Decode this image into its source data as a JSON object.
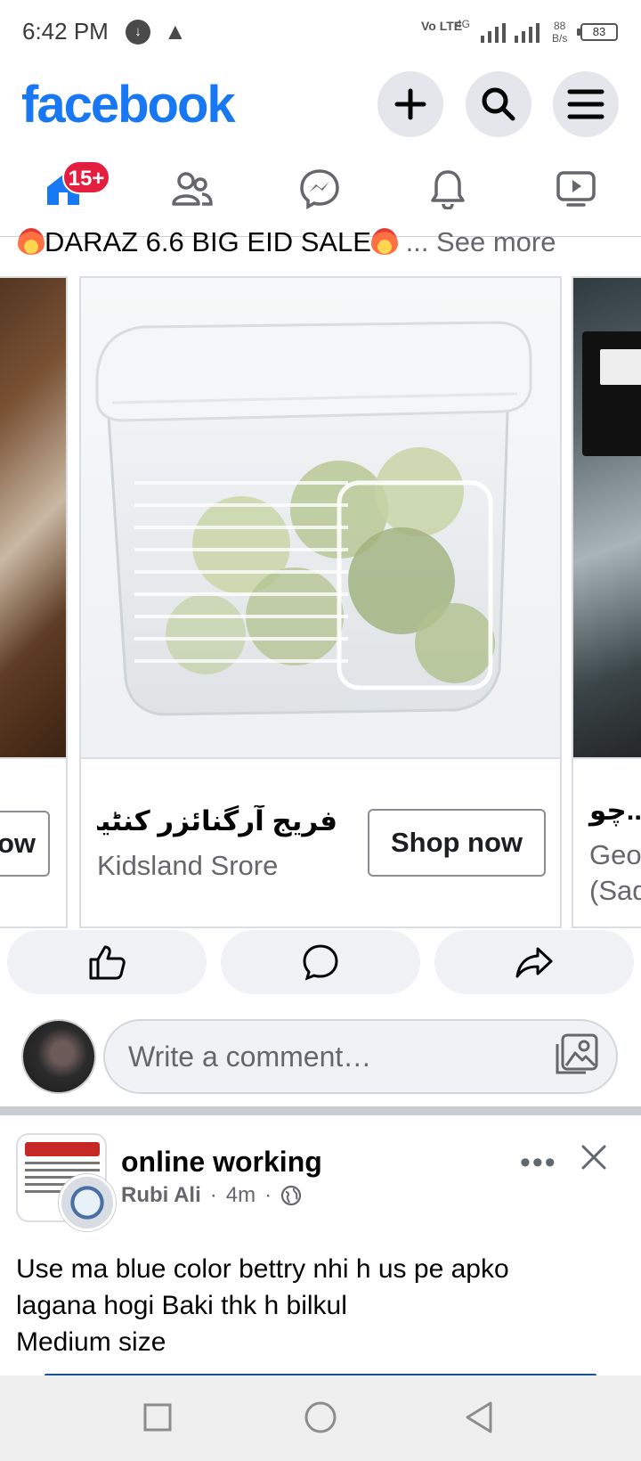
{
  "status_bar": {
    "time": "6:42 PM",
    "network_type": "Vo LTE",
    "signal_label": "4G",
    "speed_value": "88",
    "speed_unit": "B/s",
    "battery": "83"
  },
  "header": {
    "logo": "facebook"
  },
  "nav": {
    "home_badge": "15+"
  },
  "ad_post": {
    "text": "DARAZ 6.6 BIG EID SALE",
    "see_more": "... See more",
    "cards": [
      {
        "subtitle_partial": "ow"
      },
      {
        "title": "فریج آرگنائزر کنٹین...",
        "subtitle": "Kidsland Srore",
        "button": "Shop now"
      },
      {
        "title_partial": "چو...",
        "subtitle_line1": "Geo",
        "subtitle_line2": "(Sad"
      }
    ]
  },
  "comment": {
    "placeholder": "Write a comment…"
  },
  "post2": {
    "group": "online working",
    "author": "Rubi Ali",
    "time": "4m",
    "separator": "·",
    "body_lines": [
      "Use ma blue color bettry nhi h us pe apko",
      "lagana hogi Baki thk h bilkul",
      "Medium size"
    ]
  },
  "colors": {
    "brand": "#1877f2",
    "badge": "#e41e3f",
    "secondary_text": "#65676b"
  }
}
